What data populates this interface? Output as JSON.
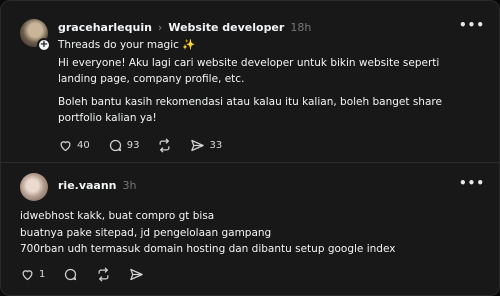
{
  "post1": {
    "username": "graceharlequin",
    "topic": "Website developer",
    "time": "18h",
    "line1": "Threads do your magic ✨",
    "para1": "Hi everyone! Aku lagi cari website developer untuk bikin website seperti landing page, company profile, etc.",
    "para2": "Boleh bantu kasih rekomendasi atau kalau itu kalian, boleh banget share portfolio kalian ya!",
    "likes": "40",
    "replies": "93",
    "shares": "33"
  },
  "post2": {
    "username": "rie.vaann",
    "time": "3h",
    "line1": "idwebhost kakk, buat compro gt bisa",
    "line2": "buatnya pake sitepad, jd pengelolaan gampang",
    "line3": "700rban udh termasuk domain hosting dan dibantu setup google index",
    "likes": "1"
  },
  "icons": {
    "chevron": "chevron-right-icon",
    "more": "more-horizontal-icon",
    "like": "heart-icon",
    "reply": "comment-icon",
    "repost": "repost-icon",
    "share": "send-icon",
    "badge": "plus-icon"
  },
  "colors": {
    "background": "#181818",
    "text": "#f3f5f7",
    "muted": "#777777"
  }
}
